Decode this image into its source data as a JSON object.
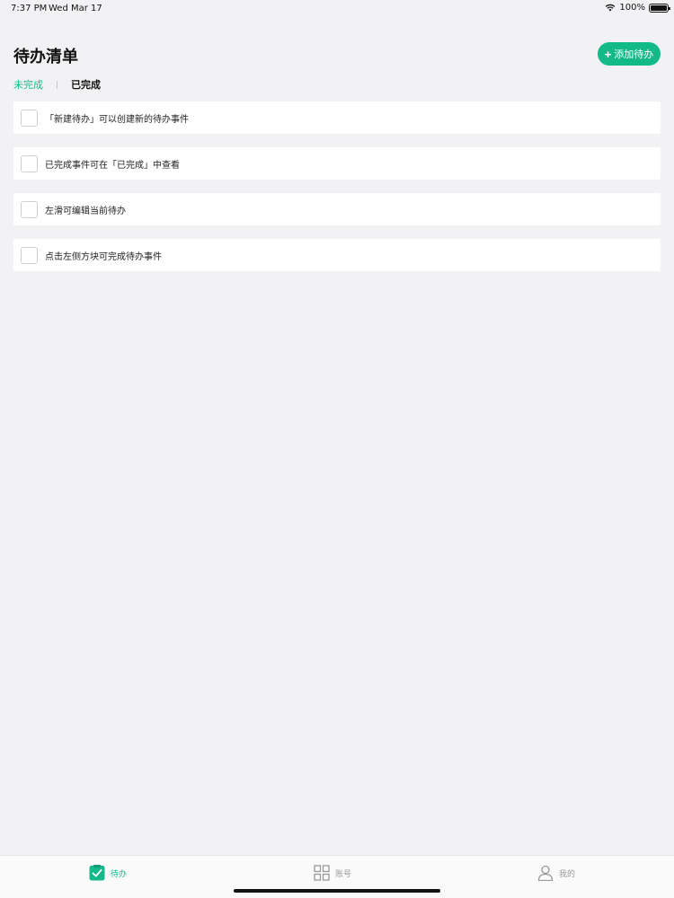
{
  "status_bar": {
    "time": "7:37 PM",
    "date": "Wed Mar 17",
    "battery": "100%",
    "wifi_icon": "wifi-icon",
    "battery_icon": "battery-icon"
  },
  "header": {
    "title": "待办清单",
    "add_button_label": "添加待办",
    "add_button_icon": "plus-icon",
    "accent_color": "#14b98a"
  },
  "tabs": [
    {
      "label": "未完成",
      "active": true
    },
    {
      "label": "已完成",
      "active": false
    }
  ],
  "todos": [
    {
      "text": "「新建待办」可以创建新的待办事件",
      "done": false
    },
    {
      "text": "已完成事件可在「已完成」中查看",
      "done": false
    },
    {
      "text": "左滑可编辑当前待办",
      "done": false
    },
    {
      "text": "点击左侧方块可完成待办事件",
      "done": false
    }
  ],
  "tab_bar": [
    {
      "label": "待办",
      "icon": "check-square-icon",
      "active": true
    },
    {
      "label": "账号",
      "icon": "grid-icon",
      "active": false
    },
    {
      "label": "我的",
      "icon": "person-icon",
      "active": false
    }
  ]
}
